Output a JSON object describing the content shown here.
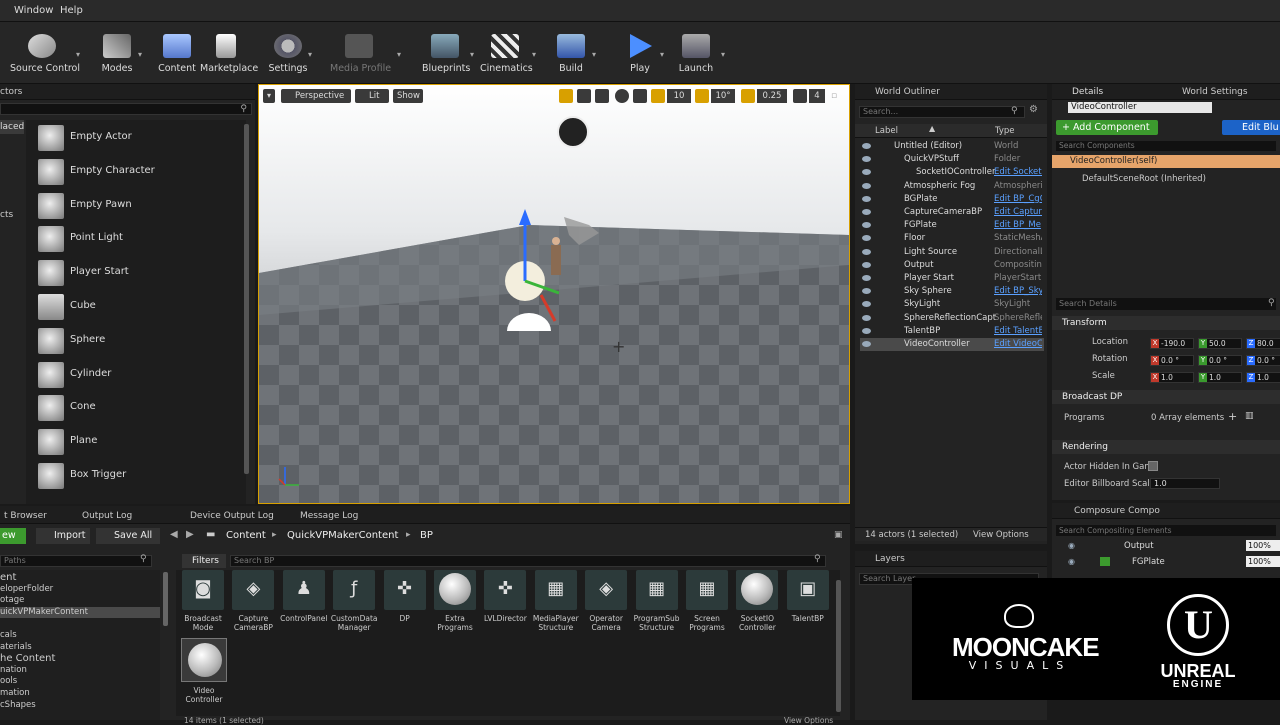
{
  "menu": {
    "window": "Window",
    "help": "Help"
  },
  "toolbar": {
    "buttons": [
      "Source Control",
      "Modes",
      "Content",
      "Marketplace",
      "Settings",
      "Media Profile",
      "Blueprints",
      "Cinematics",
      "Build",
      "Play",
      "Launch"
    ]
  },
  "place_panel": {
    "header": "ctors",
    "side_labels": [
      "laced",
      "cts"
    ],
    "items": [
      "Empty Actor",
      "Empty Character",
      "Empty Pawn",
      "Point Light",
      "Player Start",
      "Cube",
      "Sphere",
      "Cylinder",
      "Cone",
      "Plane",
      "Box Trigger"
    ]
  },
  "viewport": {
    "perspective": "Perspective",
    "lit": "Lit",
    "show": "Show",
    "grid_snap": "10",
    "rot_snap": "10°",
    "scale_snap": "0.25",
    "cam_speed": "4"
  },
  "outliner": {
    "title": "World Outliner",
    "search_placeholder": "Search...",
    "col_label": "Label",
    "col_type": "Type",
    "rows": [
      {
        "name": "Untitled (Editor)",
        "type": "World",
        "link": false
      },
      {
        "name": "QuickVPStuff",
        "type": "Folder",
        "link": false
      },
      {
        "name": "SocketIOController",
        "type": "Edit SocketI",
        "link": true
      },
      {
        "name": "Atmospheric Fog",
        "type": "AtmosphericF",
        "link": false
      },
      {
        "name": "BGPlate",
        "type": "Edit BP_CgC",
        "link": true
      },
      {
        "name": "CaptureCameraBP",
        "type": "Edit Capture",
        "link": true
      },
      {
        "name": "FGPlate",
        "type": "Edit BP_Me",
        "link": true
      },
      {
        "name": "Floor",
        "type": "StaticMeshA",
        "link": false
      },
      {
        "name": "Light Source",
        "type": "DirectionalLi",
        "link": false
      },
      {
        "name": "Output",
        "type": "Compositing",
        "link": false
      },
      {
        "name": "Player Start",
        "type": "PlayerStart",
        "link": false
      },
      {
        "name": "Sky Sphere",
        "type": "Edit BP_Sky",
        "link": true
      },
      {
        "name": "SkyLight",
        "type": "SkyLight",
        "link": false
      },
      {
        "name": "SphereReflectionCapt",
        "type": "SphereReflec",
        "link": false
      },
      {
        "name": "TalentBP",
        "type": "Edit TalentE",
        "link": true
      },
      {
        "name": "VideoController",
        "type": "Edit VideoC",
        "link": true
      }
    ],
    "actor_count": "14 actors (1 selected)",
    "view_options": "View Options"
  },
  "layers": {
    "title": "Layers",
    "search_placeholder": "Search Layer"
  },
  "details": {
    "tab_details": "Details",
    "tab_world": "World Settings",
    "object_name": "VideoController",
    "add_component": "+ Add Component",
    "edit_blueprint": "Edit Blu",
    "search_components": "Search Components",
    "comp_self": "VideoController(self)",
    "comp_root": "DefaultSceneRoot (Inherited)",
    "search_details": "Search Details",
    "transform": "Transform",
    "location": "Location",
    "rotation": "Rotation",
    "scale": "Scale",
    "loc": [
      "-190.0",
      "50.0",
      "80.0"
    ],
    "rot": [
      "0.0 °",
      "0.0 °",
      "0.0 °"
    ],
    "scl": [
      "1.0",
      "1.0",
      "1.0"
    ],
    "broadcast": "Broadcast DP",
    "programs": "Programs",
    "programs_value": "0 Array elements",
    "rendering": "Rendering",
    "hidden": "Actor Hidden In Game",
    "billboard": "Editor Billboard Scale",
    "billboard_value": "1.0"
  },
  "composure": {
    "title": "Composure Compo",
    "search_placeholder": "Search Compositing Elements",
    "rows": [
      {
        "name": "Output",
        "pct": "100%"
      },
      {
        "name": "FGPlate",
        "pct": "100%"
      }
    ]
  },
  "content_browser": {
    "tabs": [
      "t Browser",
      "Output Log",
      "Device Output Log",
      "Message Log"
    ],
    "new": "ew",
    "import": "Import",
    "save_all": "Save All",
    "crumbs": [
      "Content",
      "QuickVPMakerContent",
      "BP"
    ],
    "paths_placeholder": "Paths",
    "filters": "Filters",
    "search_placeholder": "Search BP",
    "tree": [
      "ent",
      "eloperFolder",
      "otage",
      "uickVPMakerContent",
      "",
      "cals",
      "aterials",
      "he Content",
      "nation",
      "ools",
      "mation",
      "cShapes"
    ],
    "assets": [
      {
        "name": "Broadcast Mode",
        "glyph": "◙"
      },
      {
        "name": "Capture CameraBP",
        "glyph": "◈"
      },
      {
        "name": "ControlPanel",
        "glyph": "♟"
      },
      {
        "name": "CustomData Manager",
        "glyph": "ƒ"
      },
      {
        "name": "DP",
        "glyph": "✜"
      },
      {
        "name": "Extra Programs",
        "glyph": ""
      },
      {
        "name": "LVLDirector",
        "glyph": "✜"
      },
      {
        "name": "MediaPlayer Structure",
        "glyph": "▦"
      },
      {
        "name": "Operator Camera",
        "glyph": "◈"
      },
      {
        "name": "ProgramSub Structure",
        "glyph": "▦"
      },
      {
        "name": "Screen Programs",
        "glyph": "▦"
      },
      {
        "name": "SocketIO Controller",
        "glyph": ""
      },
      {
        "name": "TalentBP",
        "glyph": "▣"
      }
    ],
    "video_asset": "Video Controller",
    "status": "14 items (1 selected)",
    "view_options": "View Options"
  },
  "watermark": {
    "brand1": "MOONCAKE",
    "brand1_sub": "VISUALS",
    "brand2": "UNREAL",
    "brand2_sub": "ENGINE"
  }
}
